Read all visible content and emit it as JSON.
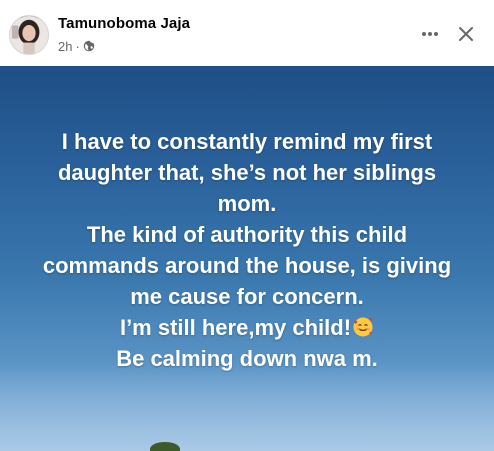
{
  "post": {
    "author_name": "Tamunoboma Jaja",
    "timestamp": "2h",
    "separator": "·",
    "privacy_icon": "globe-icon",
    "more_icon": "more-icon",
    "close_icon": "close-icon",
    "lines": [
      "I have to constantly remind my first",
      "daughter that, she’s not her siblings",
      "mom.",
      "The kind of authority this child",
      "commands around the house, is giving",
      "me cause for concern.",
      "I’m still here,my child!",
      "Be calming down nwa m."
    ],
    "emoji": "smiling-face-with-hearts",
    "colors": {
      "background_top": "#1e4f85",
      "background_bottom": "#8fb8dd",
      "text": "#ffffff"
    }
  }
}
